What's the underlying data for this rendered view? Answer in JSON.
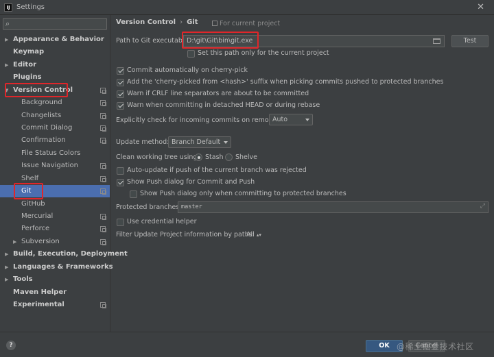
{
  "window": {
    "title": "Settings",
    "app_icon_letter": "IJ"
  },
  "search": {
    "placeholder": "",
    "value": ""
  },
  "sidebar": {
    "items": [
      {
        "label": "Appearance & Behavior",
        "arrow": "▶"
      },
      {
        "label": "Keymap"
      },
      {
        "label": "Editor",
        "arrow": "▶"
      },
      {
        "label": "Plugins"
      },
      {
        "label": "Version Control",
        "arrow": "▼"
      },
      {
        "label": "Background"
      },
      {
        "label": "Changelists"
      },
      {
        "label": "Commit Dialog"
      },
      {
        "label": "Confirmation"
      },
      {
        "label": "File Status Colors"
      },
      {
        "label": "Issue Navigation"
      },
      {
        "label": "Shelf"
      },
      {
        "label": "Git"
      },
      {
        "label": "GitHub"
      },
      {
        "label": "Mercurial"
      },
      {
        "label": "Perforce"
      },
      {
        "label": "Subversion",
        "arrow": "▶"
      },
      {
        "label": "Build, Execution, Deployment",
        "arrow": "▶"
      },
      {
        "label": "Languages & Frameworks",
        "arrow": "▶"
      },
      {
        "label": "Tools",
        "arrow": "▶"
      },
      {
        "label": "Maven Helper"
      },
      {
        "label": "Experimental"
      }
    ]
  },
  "header": {
    "crumb1": "Version Control",
    "sep": "›",
    "crumb2": "Git",
    "for_project": "For current project"
  },
  "git": {
    "path_label": "Path to Git executable:",
    "path_value": "D:\\git\\Git\\bin\\git.exe",
    "test_label": "Test",
    "project_only_label": "Set this path only for the current project",
    "opt1": "Commit automatically on cherry-pick",
    "opt2": "Add the 'cherry-picked from <hash>' suffix when picking commits pushed to protected branches",
    "opt3": "Warn if CRLF line separators are about to be committed",
    "opt4": "Warn when committing in detached HEAD or during rebase",
    "incoming_label": "Explicitly check for incoming commits on remotes:",
    "incoming_value": "Auto",
    "update_label": "Update method:",
    "update_value": "Branch Default",
    "clean_label": "Clean working tree using:",
    "stash_label": "Stash",
    "shelve_label": "Shelve",
    "autoupdate_label": "Auto-update if push of the current branch was rejected",
    "showpush_label": "Show Push dialog for Commit and Push",
    "showpush_protected_label": "Show Push dialog only when committing to protected branches",
    "protected_label": "Protected branches:",
    "protected_value": "master",
    "credential_label": "Use credential helper",
    "filter_label": "Filter Update Project information by paths:",
    "filter_value": "All"
  },
  "footer": {
    "help": "?",
    "ok": "OK",
    "cancel": "Cancel",
    "watermark": "@稀土掘金技术社区"
  },
  "colors": {
    "accent": "#4b6eaf",
    "annotation": "#e0262a",
    "ok": "#365880"
  }
}
